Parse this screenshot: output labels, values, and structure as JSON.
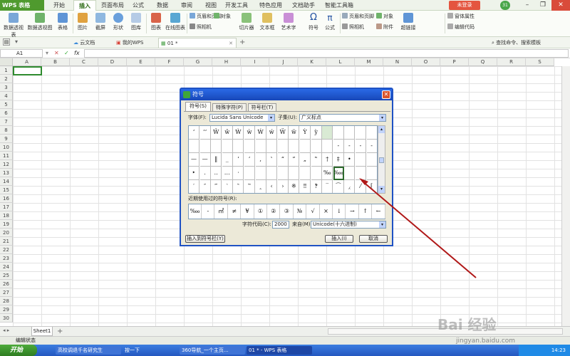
{
  "app": {
    "name": "WPS 表格"
  },
  "menu": {
    "tabs": [
      "开始",
      "插入",
      "页面布局",
      "公式",
      "数据",
      "审阅",
      "视图",
      "开发工具",
      "特色应用",
      "文档助手",
      "智能工具箱"
    ],
    "active": "插入",
    "login": "未登录",
    "badge": "31"
  },
  "ribbon": {
    "items": [
      "数据透视表",
      "数据透视图",
      "表格",
      "图片",
      "截屏",
      "形状",
      "图库",
      "图表",
      "在线图表",
      "切片器",
      "文本框",
      "艺术字",
      "符号",
      "公式",
      "超链接",
      "附件",
      "编辑代码"
    ],
    "small": [
      "页眉和页脚",
      "对象",
      "照相机",
      "窗体属性"
    ]
  },
  "doctabs": {
    "tabs": [
      "云文档",
      "我的WPS",
      "01 *"
    ]
  },
  "rightlinks": {
    "text": "查找命令、搜索模板"
  },
  "formula": {
    "cell": "A1",
    "fx": "fx"
  },
  "grid": {
    "columns": [
      "A",
      "B",
      "C",
      "D",
      "E",
      "F",
      "G",
      "H",
      "I",
      "J",
      "K",
      "L",
      "M",
      "N",
      "O",
      "P",
      "Q",
      "R",
      "S"
    ],
    "rows": [
      "1",
      "2",
      "3",
      "4",
      "5",
      "6",
      "7",
      "8",
      "9",
      "10",
      "11",
      "12",
      "13",
      "14",
      "15",
      "16",
      "17",
      "18",
      "19",
      "20",
      "21",
      "22",
      "23",
      "24",
      "25",
      "26",
      "27",
      "28",
      "29",
      "30"
    ]
  },
  "sheet": {
    "tab": "Sheet1",
    "add": "+",
    "status": "编辑状态"
  },
  "dialog": {
    "title": "符号",
    "tabs": [
      "符号(S)",
      "特殊字符(P)",
      "符号栏(T)"
    ],
    "font_label": "字体(F):",
    "font_value": "Lucida Sans Unicode",
    "subset_label": "子集(U):",
    "subset_value": "广义标点",
    "symbols": [
      [
        "ʻ",
        "ʻʻ",
        "Ŵ",
        "ŵ",
        "Ẁ",
        "ẁ",
        "Ẃ",
        "ẃ",
        "Ẅ",
        "ẅ",
        "Ỳ",
        "ỳ",
        "",
        "",
        "",
        "",
        ""
      ],
      [
        "",
        "",
        "",
        "",
        "",
        "",
        "",
        "",
        "",
        "",
        "",
        "",
        "",
        "-",
        "-",
        "-",
        "-"
      ],
      [
        "—",
        "—",
        "‖",
        "_",
        "‘",
        "’",
        "‚",
        "‛",
        "“",
        "”",
        "„",
        "‟",
        "†",
        "‡",
        "•",
        "",
        ""
      ],
      [
        "‣",
        "․",
        "‥",
        "…",
        "‧",
        "",
        "",
        "",
        "",
        "",
        "",
        "",
        "‰",
        "‱",
        "",
        "",
        " "
      ],
      [
        "′",
        "″",
        "‴",
        "‵",
        "‶",
        "‷",
        "‸",
        "‹",
        "›",
        "※",
        "‼",
        "‽",
        "‾",
        "⁀",
        "⁁",
        "⁄",
        "⁅"
      ]
    ],
    "recent_label": "近期使用过的符号(R):",
    "recent": [
      "‱",
      "-",
      "㎡",
      "≠",
      "¥",
      "①",
      "②",
      "③",
      "№",
      "√",
      "×",
      "↓",
      "→",
      "↑",
      "←"
    ],
    "code_label": "字符代码(C):",
    "code_value": "2000",
    "from_label": "来自(M):",
    "from_value": "Unicode(十六进制)",
    "insert_to_bar": "插入到符号栏(Y)",
    "insert": "插入(I)",
    "cancel": "取消"
  },
  "taskbar": {
    "start": "开始",
    "tasks": [
      "高校调退千名研究生",
      "按一下",
      "360导航_一个主页...",
      "01 * - WPS 表格"
    ],
    "clock": "14:23"
  },
  "watermark": {
    "text": "Bai 经验",
    "url": "jingyan.baidu.com"
  }
}
